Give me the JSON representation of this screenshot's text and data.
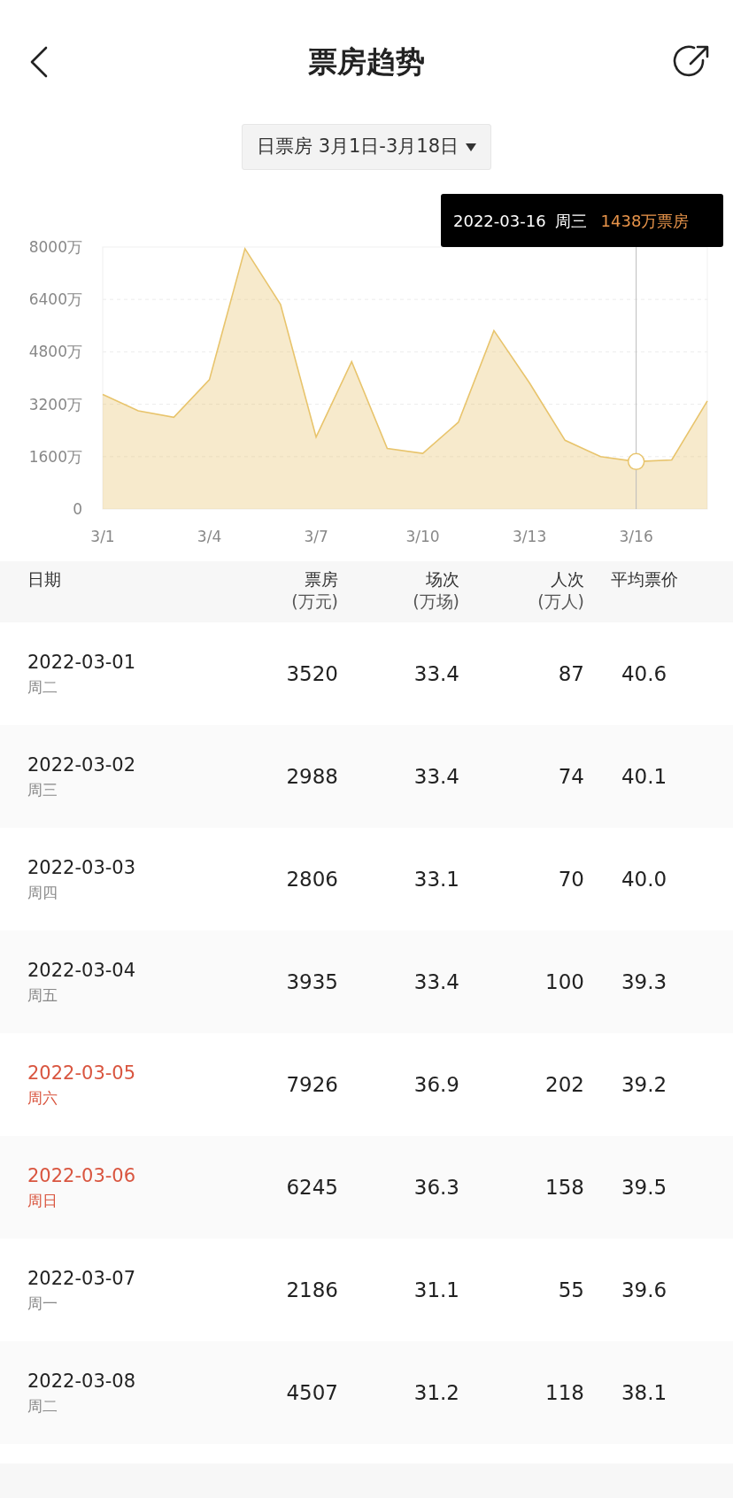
{
  "header": {
    "title": "票房趋势"
  },
  "range_picker": {
    "label": "日票房 3月1日-3月18日"
  },
  "chart": {
    "tooltip": {
      "date": "2022-03-16",
      "weekday": "周三",
      "value": "1438万票房"
    },
    "chart_data": {
      "type": "area",
      "categories": [
        "3/1",
        null,
        null,
        "3/4",
        null,
        null,
        "3/7",
        null,
        null,
        "3/10",
        null,
        null,
        "3/13",
        null,
        null,
        "3/16",
        null,
        null
      ],
      "series": [
        {
          "color": "#e8c46c",
          "values": [
            3500,
            3000,
            2800,
            3950,
            7950,
            6250,
            2200,
            4500,
            1850,
            1700,
            2650,
            5450,
            3850,
            2100,
            1600,
            1450,
            1500,
            3300
          ]
        }
      ],
      "ylim": [
        0,
        8000
      ],
      "yticks": [
        {
          "value": 0,
          "label": "0"
        },
        {
          "value": 1600,
          "label": "1600万"
        },
        {
          "value": 3200,
          "label": "3200万"
        },
        {
          "value": 4800,
          "label": "4800万"
        },
        {
          "value": 6400,
          "label": "6400万"
        },
        {
          "value": 8000,
          "label": "8000万"
        }
      ],
      "grid": true,
      "annotations": [
        {
          "x": "3/16"
        }
      ]
    }
  },
  "table": {
    "columns": [
      {
        "label": "日期"
      },
      {
        "label": "票房",
        "unit": "(万元)"
      },
      {
        "label": "场次",
        "unit": "(万场)"
      },
      {
        "label": "人次",
        "unit": "(万人)"
      },
      {
        "label": "平均票价"
      }
    ],
    "rows": [
      {
        "weekend": false,
        "cells": [
          {
            "date": "2022-03-01",
            "weekday": "周二"
          },
          "3520",
          "33.4",
          "87",
          "40.6"
        ]
      },
      {
        "weekend": false,
        "cells": [
          {
            "date": "2022-03-02",
            "weekday": "周三"
          },
          "2988",
          "33.4",
          "74",
          "40.1"
        ]
      },
      {
        "weekend": false,
        "cells": [
          {
            "date": "2022-03-03",
            "weekday": "周四"
          },
          "2806",
          "33.1",
          "70",
          "40.0"
        ]
      },
      {
        "weekend": false,
        "cells": [
          {
            "date": "2022-03-04",
            "weekday": "周五"
          },
          "3935",
          "33.4",
          "100",
          "39.3"
        ]
      },
      {
        "weekend": true,
        "cells": [
          {
            "date": "2022-03-05",
            "weekday": "周六"
          },
          "7926",
          "36.9",
          "202",
          "39.2"
        ]
      },
      {
        "weekend": true,
        "cells": [
          {
            "date": "2022-03-06",
            "weekday": "周日"
          },
          "6245",
          "36.3",
          "158",
          "39.5"
        ]
      },
      {
        "weekend": false,
        "cells": [
          {
            "date": "2022-03-07",
            "weekday": "周一"
          },
          "2186",
          "31.1",
          "55",
          "39.6"
        ]
      },
      {
        "weekend": false,
        "cells": [
          {
            "date": "2022-03-08",
            "weekday": "周二"
          },
          "4507",
          "31.2",
          "118",
          "38.1"
        ]
      }
    ]
  }
}
